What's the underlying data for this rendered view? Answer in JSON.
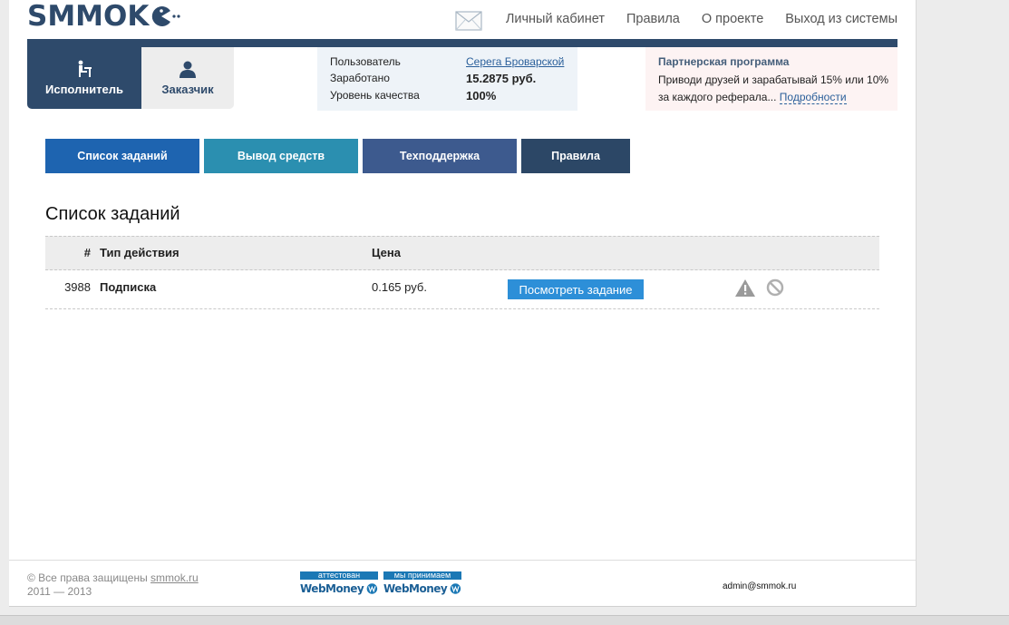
{
  "header": {
    "logo_text": "SMMOK",
    "nav": [
      "Личный кабинет",
      "Правила",
      "О проекте",
      "Выход из системы"
    ]
  },
  "roles": {
    "executor": "Исполнитель",
    "customer": "Заказчик"
  },
  "user": {
    "user_label": "Пользователь",
    "user_value": "Серега Броварской",
    "earned_label": "Заработано",
    "earned_value": "15.2875 руб.",
    "quality_label": "Уровень качества",
    "quality_value": "100%"
  },
  "partner": {
    "title": "Партнерская программа",
    "text": "Приводи друзей и зарабатывай 15% или 10% за каждого реферала...",
    "more": "Подробности"
  },
  "menu": [
    "Список заданий",
    "Вывод средств",
    "Техподдержка",
    "Правила"
  ],
  "page_title": "Список заданий",
  "table": {
    "columns": [
      "#",
      "Тип действия",
      "Цена"
    ],
    "rows": [
      {
        "id": "3988",
        "type": "Подписка",
        "price": "0.165 руб.",
        "action": "Посмотреть задание"
      }
    ]
  },
  "footer": {
    "copyright": "© Все права защищены",
    "site": "smmok.ru",
    "years": "2011 — 2013",
    "wm1_top": "аттестован",
    "wm2_top": "мы принимаем",
    "wm_brand": "WebMoney",
    "email": "admin@smmok.ru"
  },
  "colors": {
    "brand": "#2e4a6b",
    "accent": "#1e64b0"
  }
}
